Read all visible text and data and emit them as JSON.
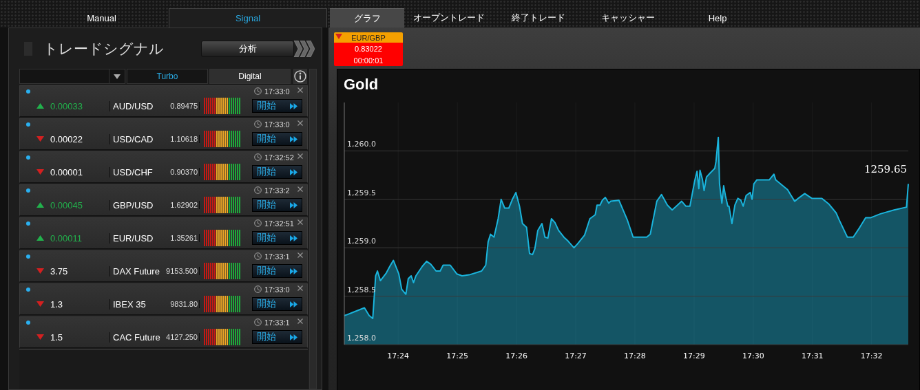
{
  "left_tabs": [
    {
      "label": "Manual",
      "selected": false
    },
    {
      "label": "Signal",
      "selected": true
    }
  ],
  "main_tabs": [
    {
      "label": "グラフ",
      "selected": true
    },
    {
      "label": "オープントレード",
      "selected": false
    },
    {
      "label": "終了トレード",
      "selected": false
    },
    {
      "label": "キャッシャー",
      "selected": false
    },
    {
      "label": "Help",
      "selected": false
    }
  ],
  "signal_panel": {
    "title": "トレードシグナル",
    "analysis_button": "分析",
    "mode_tabs": [
      {
        "label": "Turbo",
        "selected": true
      },
      {
        "label": "Digital",
        "selected": false
      }
    ],
    "signals": [
      {
        "rising": true,
        "change": "0.00033",
        "symbol": "AUD/USD",
        "price": "0.89475",
        "time": "17:33:0",
        "action": "開始"
      },
      {
        "rising": false,
        "change": "0.00022",
        "symbol": "USD/CAD",
        "price": "1.10618",
        "time": "17:33:0",
        "action": "開始"
      },
      {
        "rising": false,
        "change": "0.00001",
        "symbol": "USD/CHF",
        "price": "0.90370",
        "time": "17:32:52",
        "action": "開始"
      },
      {
        "rising": true,
        "change": "0.00045",
        "symbol": "GBP/USD",
        "price": "1.62902",
        "time": "17:33:2",
        "action": "開始"
      },
      {
        "rising": true,
        "change": "0.00011",
        "symbol": "EUR/USD",
        "price": "1.35261",
        "time": "17:32:51",
        "action": "開始"
      },
      {
        "rising": false,
        "change": "3.75",
        "symbol": "DAX Future",
        "price": "9153.500",
        "time": "17:33:1",
        "action": "開始"
      },
      {
        "rising": false,
        "change": "1.3",
        "symbol": "IBEX 35",
        "price": "9831.80",
        "time": "17:33:0",
        "action": "開始"
      },
      {
        "rising": false,
        "change": "1.5",
        "symbol": "CAC Future",
        "price": "4127.250",
        "time": "17:33:1",
        "action": "開始"
      }
    ]
  },
  "ticker": {
    "rising": false,
    "symbol": "EUR/GBP",
    "price": "0.83022",
    "timer": "00:00:01"
  },
  "chart": {
    "chart_data": {
      "type": "area",
      "title": "Gold",
      "x": [
        1043.09,
        1043.14,
        1043.43,
        1043.51,
        1043.57,
        1043.62,
        1043.65,
        1043.7,
        1043.8,
        1043.86,
        1043.92,
        1044.01,
        1044.06,
        1044.13,
        1044.17,
        1044.22,
        1044.26,
        1044.3,
        1044.41,
        1044.48,
        1044.55,
        1044.59,
        1044.64,
        1044.71,
        1044.76,
        1044.88,
        1044.99,
        1045.08,
        1045.2,
        1045.41,
        1045.48,
        1045.52,
        1045.56,
        1045.62,
        1045.69,
        1045.74,
        1045.8,
        1045.87,
        1045.93,
        1045.99,
        1046.05,
        1046.1,
        1046.17,
        1046.22,
        1046.27,
        1046.31,
        1046.36,
        1046.43,
        1046.48,
        1046.53,
        1046.59,
        1046.65,
        1046.71,
        1046.8,
        1046.87,
        1046.97,
        1047.03,
        1047.15,
        1047.24,
        1047.33,
        1047.36,
        1047.41,
        1047.45,
        1047.5,
        1047.56,
        1047.59,
        1047.73,
        1047.87,
        1047.97,
        1048.2,
        1048.26,
        1048.37,
        1048.45,
        1048.55,
        1048.63,
        1048.72,
        1048.79,
        1048.86,
        1048.93,
        1049.01,
        1049.05,
        1049.08,
        1049.1,
        1049.14,
        1049.17,
        1049.21,
        1049.27,
        1049.35,
        1049.37,
        1049.41,
        1049.43,
        1049.47,
        1049.5,
        1049.53,
        1049.57,
        1049.59,
        1049.64,
        1049.69,
        1049.74,
        1049.79,
        1049.83,
        1049.88,
        1049.95,
        1049.98,
        1050.01,
        1050.06,
        1050.27,
        1050.35,
        1050.38,
        1050.52,
        1050.58,
        1050.64,
        1050.7,
        1050.76,
        1050.87,
        1050.99,
        1051.16,
        1051.28,
        1051.4,
        1051.45,
        1051.59,
        1051.69,
        1051.8,
        1051.9,
        1051.98,
        1052.15,
        1052.38,
        1052.59,
        1052.62
      ],
      "series": [
        {
          "color": "#1ab4dc",
          "values": [
            1258.3,
            1258.31,
            1258.38,
            1258.3,
            1258.27,
            1258.71,
            1258.76,
            1258.66,
            1258.74,
            1258.81,
            1258.87,
            1258.73,
            1258.57,
            1258.52,
            1258.68,
            1258.71,
            1258.64,
            1258.71,
            1258.81,
            1258.86,
            1258.83,
            1258.8,
            1258.76,
            1258.76,
            1258.82,
            1258.82,
            1258.73,
            1258.71,
            1258.72,
            1258.76,
            1258.82,
            1259.06,
            1259.14,
            1259.11,
            1259.3,
            1259.5,
            1259.41,
            1259.41,
            1259.5,
            1259.57,
            1259.43,
            1259.25,
            1259.21,
            1258.94,
            1258.93,
            1258.99,
            1259.18,
            1259.25,
            1259.11,
            1259.1,
            1259.3,
            1259.26,
            1259.18,
            1259.11,
            1259.07,
            1259.0,
            1259.04,
            1259.13,
            1259.3,
            1259.34,
            1259.44,
            1259.44,
            1259.49,
            1259.52,
            1259.46,
            1259.48,
            1259.49,
            1259.29,
            1259.11,
            1259.11,
            1259.14,
            1259.48,
            1259.55,
            1259.44,
            1259.39,
            1259.44,
            1259.48,
            1259.43,
            1259.43,
            1259.69,
            1259.79,
            1259.61,
            1259.8,
            1259.71,
            1259.59,
            1259.73,
            1259.77,
            1259.82,
            1259.89,
            1260.14,
            1259.66,
            1259.46,
            1259.64,
            1259.54,
            1259.43,
            1259.43,
            1259.25,
            1259.44,
            1259.51,
            1259.49,
            1259.43,
            1259.54,
            1259.57,
            1259.5,
            1259.66,
            1259.7,
            1259.7,
            1259.76,
            1259.7,
            1259.63,
            1259.6,
            1259.54,
            1259.48,
            1259.51,
            1259.56,
            1259.51,
            1259.51,
            1259.45,
            1259.36,
            1259.29,
            1259.11,
            1259.11,
            1259.21,
            1259.31,
            1259.31,
            1259.35,
            1259.39,
            1259.42,
            1259.66
          ]
        }
      ],
      "grid": true,
      "xlim": [
        1043.09,
        1052.62
      ],
      "ylim": [
        1258.0,
        1260.5
      ],
      "xticks": [
        {
          "value": 1044,
          "label": "17:24"
        },
        {
          "value": 1045,
          "label": "17:25"
        },
        {
          "value": 1046,
          "label": "17:26"
        },
        {
          "value": 1047,
          "label": "17:27"
        },
        {
          "value": 1048,
          "label": "17:28"
        },
        {
          "value": 1049,
          "label": "17:29"
        },
        {
          "value": 1050,
          "label": "17:30"
        },
        {
          "value": 1051,
          "label": "17:31"
        },
        {
          "value": 1052,
          "label": "17:32"
        }
      ],
      "yticks": [
        {
          "value": 1258.0,
          "label": "1,258.0"
        },
        {
          "value": 1258.5,
          "label": "1,258.5"
        },
        {
          "value": 1259.0,
          "label": "1,259.0"
        },
        {
          "value": 1259.5,
          "label": "1,259.5"
        },
        {
          "value": 1260.0,
          "label": "1,260.0"
        }
      ],
      "annotations": [
        {
          "x": 1052.62,
          "y": 1259.65,
          "text": "1259.65"
        }
      ]
    }
  }
}
